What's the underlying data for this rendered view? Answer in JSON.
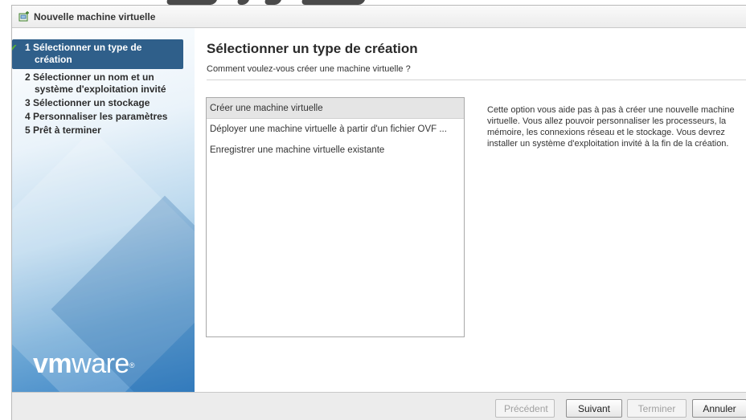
{
  "window": {
    "title": "Nouvelle machine virtuelle",
    "icon": "new-vm-icon"
  },
  "steps": [
    {
      "number": "1",
      "label": "Sélectionner un type de",
      "label2": "création",
      "state": "active-completed"
    },
    {
      "number": "2",
      "label": "Sélectionner un nom et un",
      "label2": "système d'exploitation invité",
      "state": "pending"
    },
    {
      "number": "3",
      "label": "Sélectionner un stockage",
      "state": "pending"
    },
    {
      "number": "4",
      "label": "Personnaliser les paramètres",
      "state": "pending"
    },
    {
      "number": "5",
      "label": "Prêt à terminer",
      "state": "pending"
    }
  ],
  "logo": {
    "vm": "vm",
    "ware": "ware",
    "reg": "®"
  },
  "main": {
    "heading": "Sélectionner un type de création",
    "subheading": "Comment voulez-vous créer une machine virtuelle ?",
    "options": [
      {
        "label": "Créer une machine virtuelle",
        "selected": true
      },
      {
        "label": "Déployer une machine virtuelle à partir d'un fichier OVF ...",
        "selected": false
      },
      {
        "label": "Enregistrer une machine virtuelle existante",
        "selected": false
      }
    ],
    "description": "Cette option vous aide pas à pas à créer une nouvelle machine virtuelle. Vous allez pouvoir personnaliser les processeurs, la mémoire, les connexions réseau et le stockage. Vous devrez installer un système d'exploitation invité à la fin de la création."
  },
  "footer": {
    "prev": "Précédent",
    "next": "Suivant",
    "finish": "Terminer",
    "cancel": "Annuler"
  },
  "colors": {
    "active_step_bg": "#2f5f8a",
    "check_color": "#5bb530",
    "panel_blue": "#3d85c6"
  }
}
